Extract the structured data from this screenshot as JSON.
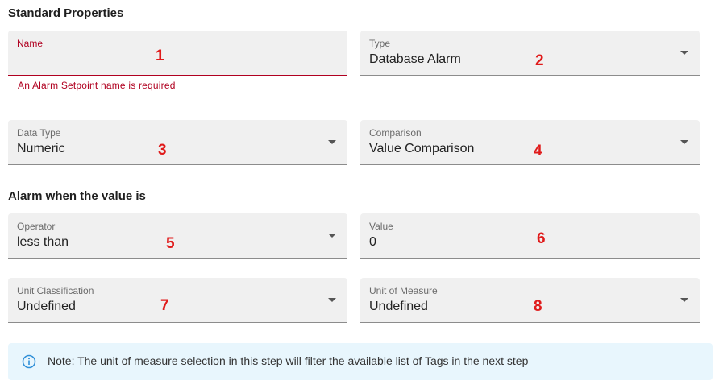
{
  "sections": {
    "standard_properties": "Standard Properties",
    "alarm_when": "Alarm when the value is"
  },
  "fields": {
    "name": {
      "label": "Name",
      "value": "",
      "error": "An Alarm Setpoint name is required",
      "annotation": "1"
    },
    "type": {
      "label": "Type",
      "value": "Database Alarm",
      "annotation": "2"
    },
    "data_type": {
      "label": "Data Type",
      "value": "Numeric",
      "annotation": "3"
    },
    "comparison": {
      "label": "Comparison",
      "value": "Value Comparison",
      "annotation": "4"
    },
    "operator": {
      "label": "Operator",
      "value": "less than",
      "annotation": "5"
    },
    "value": {
      "label": "Value",
      "value": "0",
      "annotation": "6"
    },
    "unit_classification": {
      "label": "Unit Classification",
      "value": "Undefined",
      "annotation": "7"
    },
    "unit_of_measure": {
      "label": "Unit of Measure",
      "value": "Undefined",
      "annotation": "8"
    }
  },
  "note": {
    "icon": "info-icon",
    "text": "Note: The unit of measure selection in this step will filter the available list of Tags in the next step"
  },
  "colors": {
    "error": "#b00020",
    "annotation": "#e01b1b",
    "field_bg": "#f0f0f0",
    "note_bg": "#e8f6fd",
    "info_icon": "#2f8fd8"
  }
}
